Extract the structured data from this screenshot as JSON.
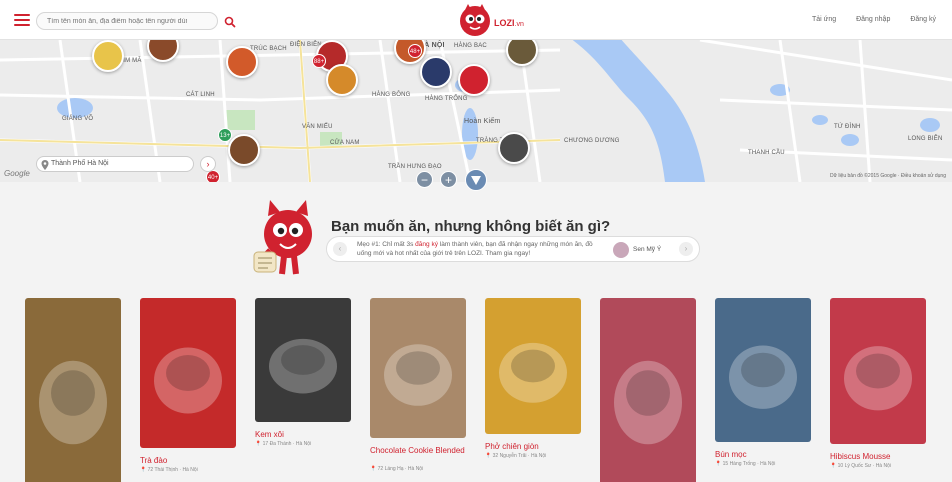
{
  "header": {
    "search_placeholder": "Tìm tên món ăn, địa điểm hoặc tên người dùng",
    "logo_text": "LOZI",
    "logo_suffix": ".vn",
    "login": "Tải ứng",
    "register": "Đăng nhập",
    "signup": "Đăng ký"
  },
  "map": {
    "location_value": "Thành Phố Hà Nội",
    "labels": [
      "HÀ NỘI",
      "HÀNG BAC",
      "CÁT LINH",
      "KIM MÃ",
      "ĐIỆN BIÊN",
      "HÀNG BÔNG",
      "HÀNG TRỐNG",
      "VĂN MIẾU",
      "CỬA NAM",
      "TRÀNG TIỀN",
      "Hoàn Kiếm",
      "CHƯƠNG DƯƠNG",
      "GIẢNG VÕ",
      "THANH CẦU",
      "TỨ ĐÌNH",
      "LONG BIÊN",
      "TRẦN HƯNG ĐẠO",
      "TRÚC BẠCH"
    ],
    "pin_badges": [
      "88+",
      "48+",
      "13+",
      "40+"
    ],
    "google": "Google",
    "copyright": "Dữ liệu bản đồ ©2015 Google · Điều khoản sử dụng",
    "zoom_out": "−",
    "zoom_in": "+"
  },
  "promo": {
    "title": "Bạn muốn ăn, nhưng không biết ăn gì?",
    "text_before": "Mẹo #1: Chỉ mất 3s ",
    "text_link": "đăng ký",
    "text_after": " làm thành viên, bạn đã nhận ngay những món ăn, đồ uống mới và hot nhất của giới trẻ trên LOZI. Tham gia ngay!",
    "user_name": "Sen Mỹ Ý"
  },
  "cards": [
    {
      "name": "",
      "addr": "",
      "color": "#8a6a3a"
    },
    {
      "name": "Trà đào",
      "addr": "📍 72 Thái Thịnh · Hà Nội",
      "color": "#c42a2a"
    },
    {
      "name": "Kem xôi",
      "addr": "📍 17 Đa Thánh · Hà Nội",
      "color": "#3a3a3a"
    },
    {
      "name": "Chocolate Cookie Blended",
      "addr": "📍 72 Láng Hạ · Hà Nội",
      "color": "#a9896a"
    },
    {
      "name": "Phở chiên giòn",
      "addr": "📍 32 Nguyễn Trãi · Hà Nội",
      "color": "#d4a030"
    },
    {
      "name": "",
      "addr": "",
      "color": "#b14a5a"
    },
    {
      "name": "Bún mọc",
      "addr": "📍 15 Hàng Trống · Hà Nội",
      "color": "#4a6a8a"
    },
    {
      "name": "Hibiscus Mousse",
      "addr": "📍 10 Lý Quốc Sư · Hà Nội",
      "color": "#c23a4a"
    }
  ],
  "colors": {
    "accent": "#d0222f",
    "map_water": "#a9c9f5",
    "map_bg": "#ececec",
    "map_park": "#c8e6c0"
  }
}
